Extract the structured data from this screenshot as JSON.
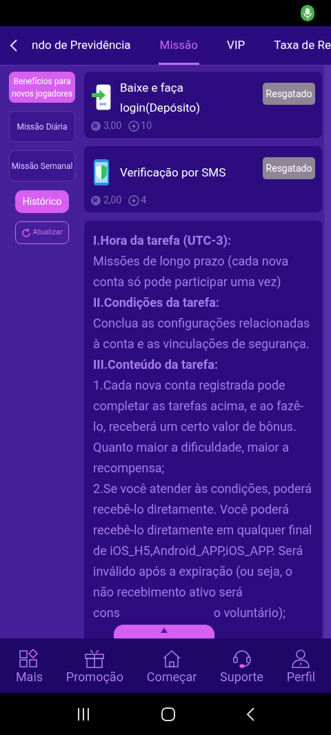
{
  "tabs": [
    {
      "label": "ndo de Previdência",
      "selected": false
    },
    {
      "label": "Missão",
      "selected": true
    },
    {
      "label": "VIP",
      "selected": false
    },
    {
      "label": "Taxa de Re",
      "selected": false
    }
  ],
  "sidebar": {
    "items": [
      {
        "label": "Benefícios para novos jogadores",
        "selected": true
      },
      {
        "label": "Missão Diária",
        "selected": false
      },
      {
        "label": "Missão Semanal",
        "selected": false
      }
    ],
    "history_button": "Histórico",
    "refresh_button": "Atualizar"
  },
  "tasks": [
    {
      "kind": "download",
      "title": "Baixe e faça login(Depósito)",
      "button": "Resgatado",
      "money": "3,00",
      "points": "10"
    },
    {
      "kind": "sms",
      "title": "Verificação por SMS",
      "button": "Resgatado",
      "money": "2,00",
      "points": "4"
    }
  ],
  "rules": [
    {
      "kind": "heading",
      "text": "I.Hora da tarefa (UTC-3):"
    },
    {
      "kind": "body",
      "text": "Missões de longo prazo (cada nova conta só pode participar uma vez)"
    },
    {
      "kind": "heading",
      "text": "II.Condições da tarefa:"
    },
    {
      "kind": "body",
      "text": "Conclua as configurações relacionadas à conta e as vinculações de segurança."
    },
    {
      "kind": "heading",
      "text": "III.Conteúdo da tarefa:"
    },
    {
      "kind": "body",
      "text": "1.Cada nova conta registrada pode completar as tarefas acima, e ao fazê-lo, receberá um certo valor de bônus. Quanto maior a dificuldade, maior a recompensa;"
    },
    {
      "kind": "body",
      "text": "2.Se você atender às condições, poderá recebê-lo diretamente. Você poderá recebê-lo diretamente em qualquer final de iOS_H5,Android_APP,iOS_APP. Será inválido após a expiração (ou seja, o não recebimento ativo será"
    }
  ],
  "rules_cut_line": {
    "left": "cons",
    "right": "o voluntário);"
  },
  "bottom_nav": [
    {
      "kind": "more",
      "label": "Mais"
    },
    {
      "kind": "gift",
      "label": "Promoção"
    },
    {
      "kind": "home",
      "label": "Começar"
    },
    {
      "kind": "support",
      "label": "Suporte"
    },
    {
      "kind": "profile",
      "label": "Perfil"
    }
  ]
}
